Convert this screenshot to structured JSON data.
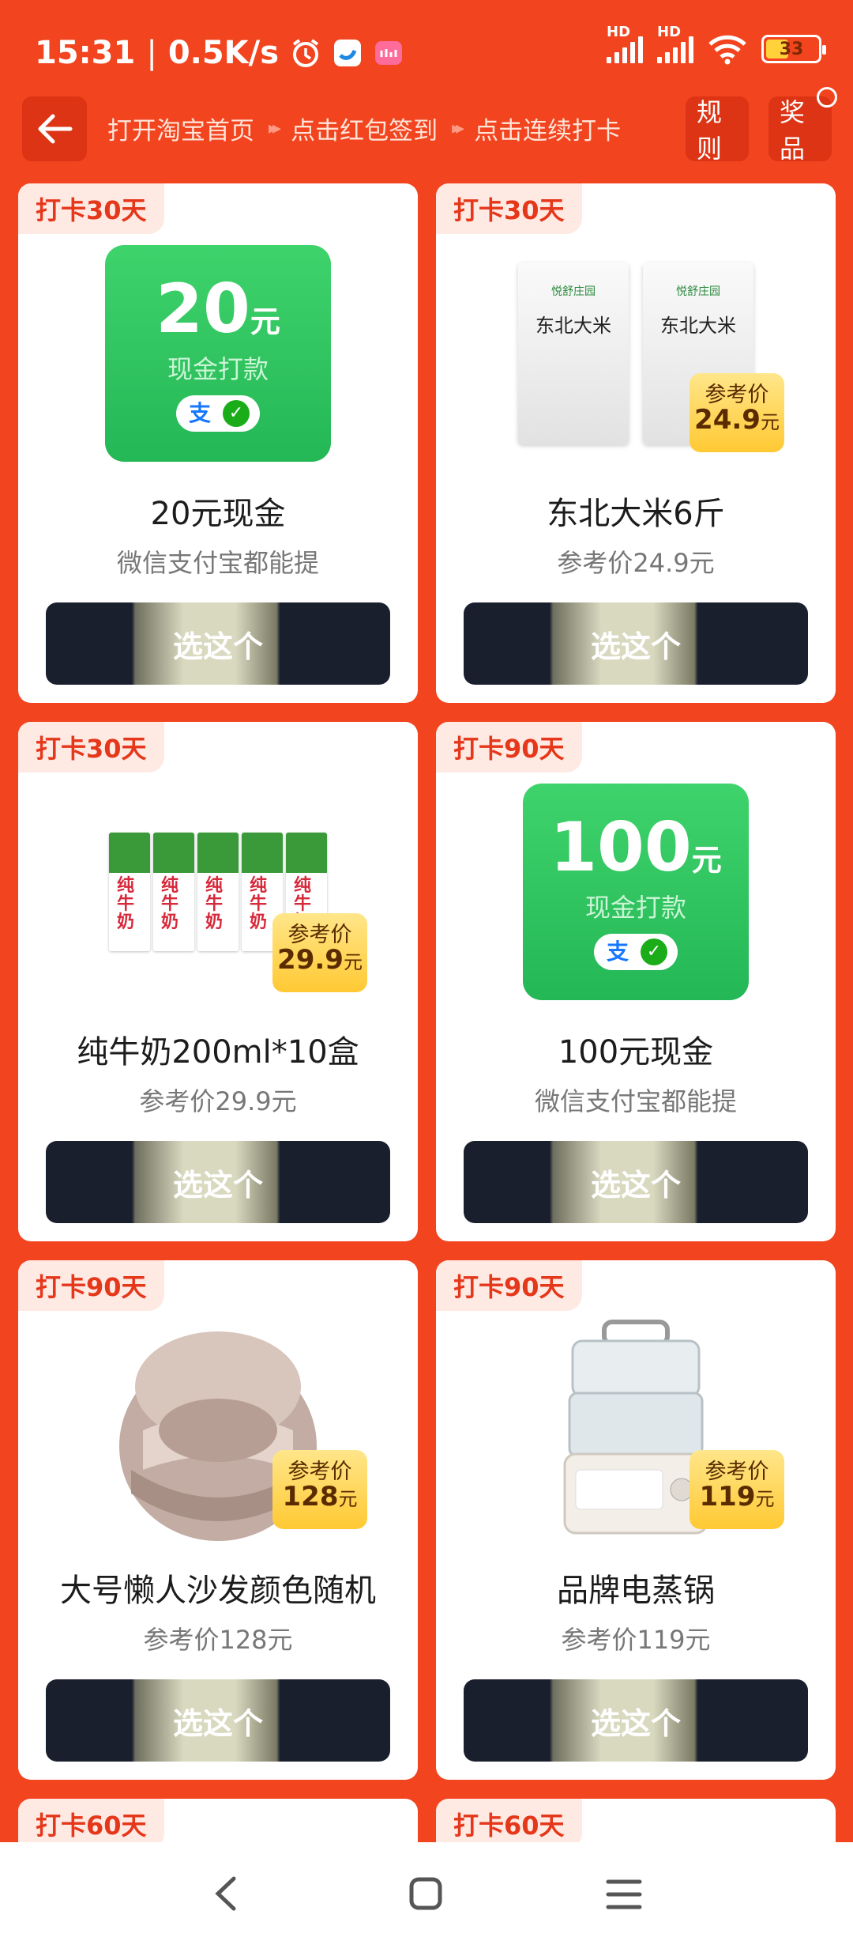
{
  "status_bar": {
    "time": "15:31",
    "separator": "|",
    "net_speed": "0.5K/s",
    "hd1": "HD",
    "hd2": "HD",
    "battery": "33"
  },
  "topbar": {
    "steps": [
      "打开淘宝首页",
      "点击红包签到",
      "点击连续打卡"
    ],
    "arrow": "▸▸",
    "rules_label": "规则",
    "prizes_label": "奖品"
  },
  "cards": [
    {
      "tag": "打卡30天",
      "title": "20元现金",
      "subtitle": "微信支付宝都能提",
      "button": "选这个",
      "cash": {
        "amount": "20",
        "unit": "元",
        "label": "现金打款"
      }
    },
    {
      "tag": "打卡30天",
      "title": "东北大米6斤",
      "subtitle": "参考价24.9元",
      "button": "选这个",
      "badge": {
        "label": "参考价",
        "price": "24.9",
        "unit": "元"
      },
      "rice": {
        "brand": "悦舒庄园",
        "name": "东北大米"
      }
    },
    {
      "tag": "打卡30天",
      "title": "纯牛奶200ml*10盒",
      "subtitle": "参考价29.9元",
      "button": "选这个",
      "badge": {
        "label": "参考价",
        "price": "29.9",
        "unit": "元"
      },
      "milk": {
        "box_text": "纯牛奶"
      }
    },
    {
      "tag": "打卡90天",
      "title": "100元现金",
      "subtitle": "微信支付宝都能提",
      "button": "选这个",
      "cash": {
        "amount": "100",
        "unit": "元",
        "label": "现金打款"
      }
    },
    {
      "tag": "打卡90天",
      "title": "大号懒人沙发颜色随机",
      "subtitle": "参考价128元",
      "button": "选这个",
      "badge": {
        "label": "参考价",
        "price": "128",
        "unit": "元"
      }
    },
    {
      "tag": "打卡90天",
      "title": "品牌电蒸锅",
      "subtitle": "参考价119元",
      "button": "选这个",
      "badge": {
        "label": "参考价",
        "price": "119",
        "unit": "元"
      }
    },
    {
      "tag": "打卡60天"
    },
    {
      "tag": "打卡60天"
    }
  ],
  "colors": {
    "bg": "#f2441f",
    "tag_text": "#e5371a",
    "cash_green": "#24b756",
    "button_dark": "#1a1f2e"
  }
}
